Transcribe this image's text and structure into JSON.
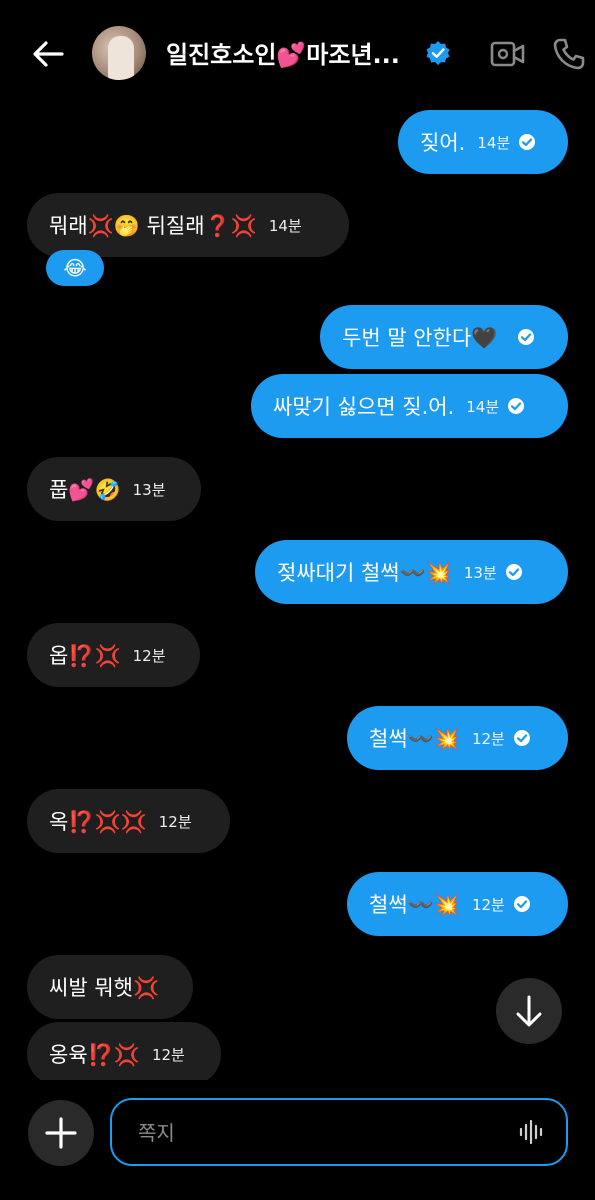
{
  "header": {
    "title": "일진호소인💕마조년...",
    "back_icon": "arrow-left-icon",
    "verified_icon": "verified-badge-icon",
    "video_icon": "video-call-icon",
    "phone_icon": "phone-call-icon"
  },
  "messages": [
    {
      "dir": "out",
      "text": "짖어.",
      "time": "14분"
    },
    {
      "dir": "in",
      "text": "뭐래💢🤭 뒤질래❓💢",
      "time": "14분",
      "reaction": "😂"
    },
    {
      "dir": "out",
      "text": "두번 말 안한다🖤",
      "time": ""
    },
    {
      "dir": "out",
      "text": "싸맞기 싫으면 짖.어.",
      "time": "14분"
    },
    {
      "dir": "in",
      "text": "풉💕🤣",
      "time": "13분"
    },
    {
      "dir": "out",
      "text": "젖싸대기 철썩〰️💥",
      "time": "13분"
    },
    {
      "dir": "in",
      "text": "옵⁉️💢",
      "time": "12분"
    },
    {
      "dir": "out",
      "text": "철썩〰️💥",
      "time": "12분"
    },
    {
      "dir": "in",
      "text": "옥⁉️💢💢",
      "time": "12분"
    },
    {
      "dir": "out",
      "text": "철썩〰️💥",
      "time": "12분"
    },
    {
      "dir": "in",
      "text": "씨발 뭐햇💢",
      "time": ""
    },
    {
      "dir": "in",
      "text": "옹육⁉️💢",
      "time": "12분"
    }
  ],
  "composer": {
    "placeholder": "쪽지",
    "add_icon": "plus-icon",
    "voice_icon": "voice-waveform-icon"
  },
  "scroll_icon": "arrow-down-icon",
  "colors": {
    "accent": "#1d9bf0",
    "incoming": "#1f1f1f",
    "background": "#000000"
  }
}
